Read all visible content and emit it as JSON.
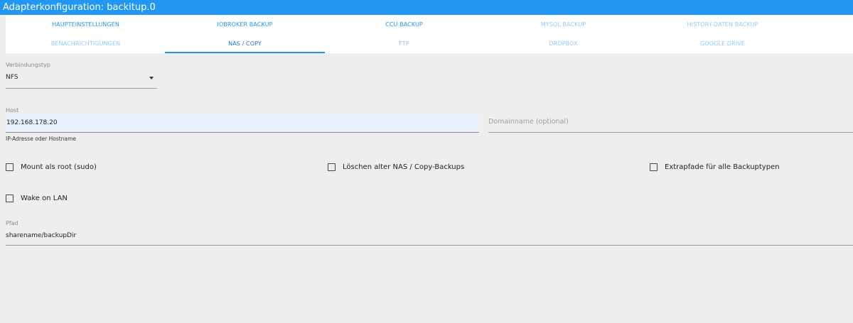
{
  "window": {
    "title": "Adapterkonfiguration: backitup.0"
  },
  "tabs": {
    "row1": [
      "HAUPTEINSTELLUNGEN",
      "IOBROKER BACKUP",
      "CCU BACKUP",
      "MYSQL BACKUP",
      "HISTORY-DATEN BACKUP"
    ],
    "row2": [
      "BENACHRICHTIGUNGEN",
      "NAS / COPY",
      "FTP",
      "DROPBOX",
      "GOOGLE DRIVE"
    ],
    "active": "NAS / COPY"
  },
  "form": {
    "connection_type": {
      "label": "Verbindungstyp",
      "value": "NFS"
    },
    "host": {
      "label": "Host",
      "value": "192.168.178.20",
      "helper": "IP-Adresse oder Hostname"
    },
    "domain": {
      "placeholder": "Domainname (optional)"
    },
    "checkboxes": {
      "mount_root": {
        "label": "Mount als root (sudo)",
        "checked": false
      },
      "delete_old": {
        "label": "Löschen alter NAS / Copy-Backups",
        "checked": false
      },
      "extra_paths": {
        "label": "Extrapfade für alle Backuptypen",
        "checked": false
      },
      "wake_on_lan": {
        "label": "Wake on LAN",
        "checked": false
      }
    },
    "path": {
      "label": "Pfad",
      "value": "sharename/backupDir"
    }
  },
  "colors": {
    "accent": "#2196f3",
    "background": "#eeeeee",
    "autofill": "#e8f0fe"
  }
}
